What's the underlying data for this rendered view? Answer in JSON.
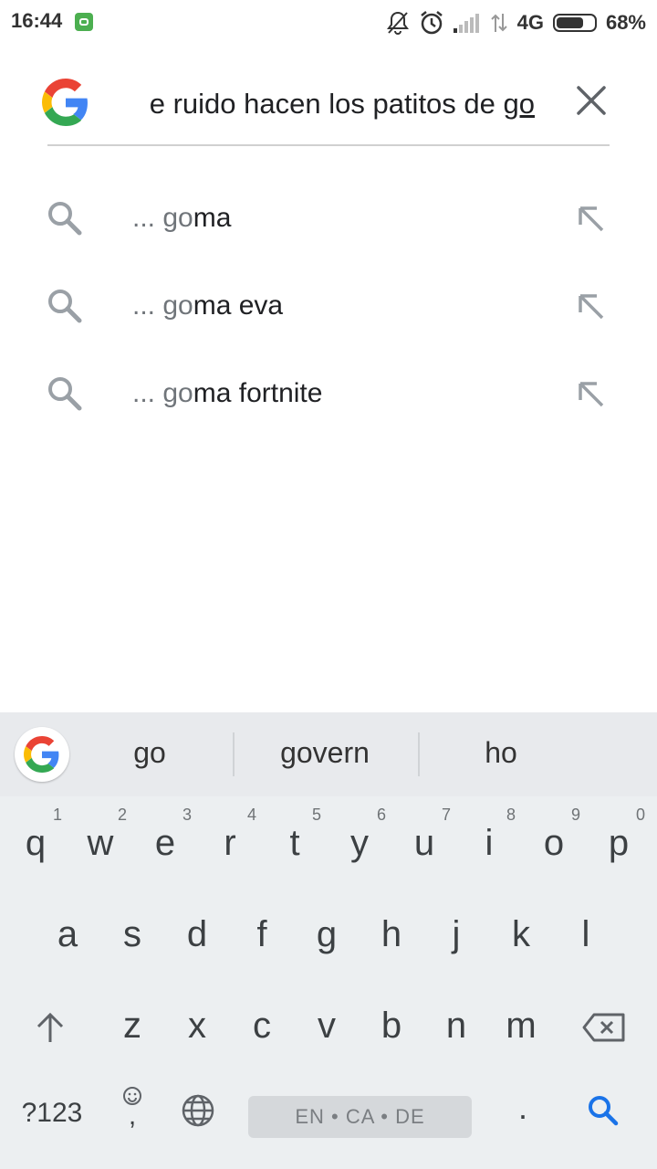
{
  "status_bar": {
    "time": "16:44",
    "network": "4G",
    "battery": "68%"
  },
  "search": {
    "query_prefix": "e ruido hacen los patitos de ",
    "query_typed": "go"
  },
  "suggestions": [
    {
      "prefix": "... ",
      "match": "go",
      "rest": "ma"
    },
    {
      "prefix": "... ",
      "match": "go",
      "rest": "ma eva"
    },
    {
      "prefix": "... ",
      "match": "go",
      "rest": "ma fortnite"
    }
  ],
  "keyboard": {
    "word_suggestions": [
      "go",
      "govern",
      "ho"
    ],
    "row1": [
      {
        "k": "q",
        "h": "1"
      },
      {
        "k": "w",
        "h": "2"
      },
      {
        "k": "e",
        "h": "3"
      },
      {
        "k": "r",
        "h": "4"
      },
      {
        "k": "t",
        "h": "5"
      },
      {
        "k": "y",
        "h": "6"
      },
      {
        "k": "u",
        "h": "7"
      },
      {
        "k": "i",
        "h": "8"
      },
      {
        "k": "o",
        "h": "9"
      },
      {
        "k": "p",
        "h": "0"
      }
    ],
    "row2": [
      "a",
      "s",
      "d",
      "f",
      "g",
      "h",
      "j",
      "k",
      "l"
    ],
    "row3": [
      "z",
      "x",
      "c",
      "v",
      "b",
      "n",
      "m"
    ],
    "symbols_key": "?123",
    "comma_key": ",",
    "period_key": ".",
    "space_label": "EN • CA • DE"
  },
  "colors": {
    "search_accent": "#1a73e8",
    "google_blue": "#4285F4",
    "google_red": "#EA4335",
    "google_yellow": "#FBBC05",
    "google_green": "#34A853"
  }
}
